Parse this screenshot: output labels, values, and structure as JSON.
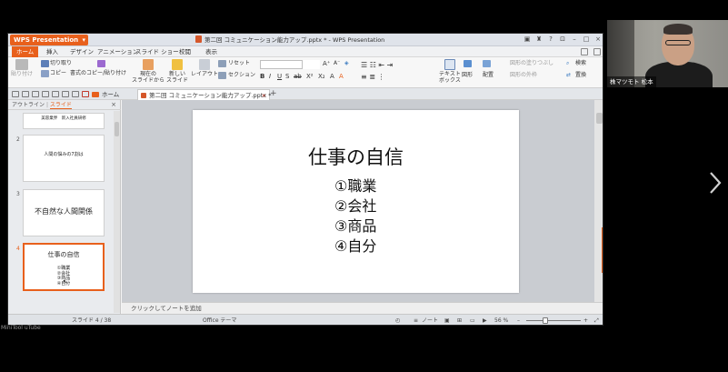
{
  "window": {
    "app_button": "WPS Presentation",
    "doc_title": "第二回 コミュニケーション能力アップ.pptx * - WPS Presentation"
  },
  "menu": [
    "ホーム",
    "挿入",
    "デザイン",
    "アニメーション",
    "スライド ショー",
    "校閲",
    "表示"
  ],
  "ribbon": {
    "paste": "貼り付け",
    "cut": "切り取り",
    "copy": "コピー",
    "format_painter": "書式のコピー/貼り付け",
    "from_current": "現在の\nスライドから",
    "new_slide": "新しい\nスライド",
    "layout": "レイアウト",
    "reset": "リセット",
    "section": "セクション",
    "text_box": "テキスト\nボックス",
    "shape": "図形",
    "arrange": "配置",
    "shape_fill": "図形の塗りつぶし",
    "shape_outline": "図形の外枠",
    "find": "検索",
    "replace": "置換"
  },
  "tabs": {
    "home": "ホーム",
    "document": "第二回 コミュニケーション能力アップ.pptx *"
  },
  "pane": {
    "outline_tab": "アウトライン",
    "slides_tab": "スライド"
  },
  "thumbnails": [
    {
      "num": "",
      "text": "美容業界　新入社員研修"
    },
    {
      "num": "2",
      "text": "人間の悩みの7割は"
    },
    {
      "num": "3",
      "text": "不自然な人間関係"
    },
    {
      "num": "4",
      "title": "仕事の自信",
      "items": [
        "①職業",
        "②会社",
        "③商品",
        "④自分"
      ]
    }
  ],
  "slide": {
    "title": "仕事の自信",
    "items": [
      "①職業",
      "②会社",
      "③商品",
      "④自分"
    ]
  },
  "notes_placeholder": "クリックしてノートを追加",
  "status": {
    "slide_count": "スライド 4 / 38",
    "theme": "Office テーマ",
    "notes": "ノート",
    "zoom": "56 %"
  },
  "webcam": {
    "name": "株マツモト 松本"
  },
  "watermark": "MiniTool uTube"
}
